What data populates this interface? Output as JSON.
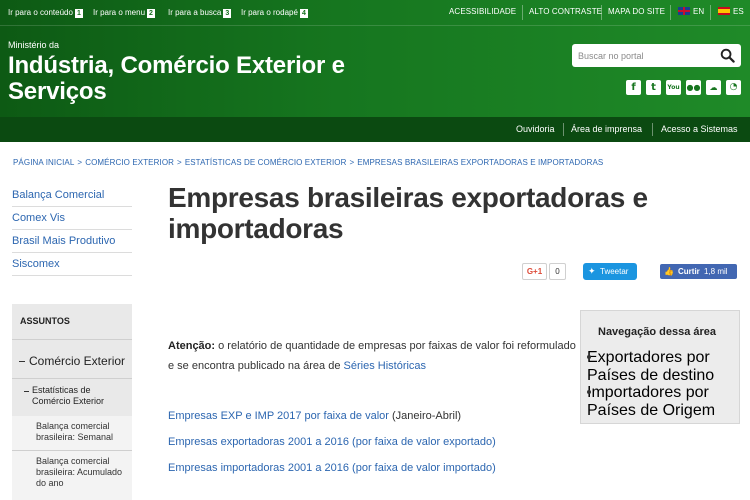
{
  "skip_links": [
    {
      "label": "Ir para o conteúdo",
      "key": "1"
    },
    {
      "label": "Ir para o menu",
      "key": "2"
    },
    {
      "label": "Ir para a busca",
      "key": "3"
    },
    {
      "label": "Ir para o rodapé",
      "key": "4"
    }
  ],
  "top_links": {
    "accessibility": "ACESSIBILIDADE",
    "contrast": "ALTO CONTRASTE",
    "sitemap": "MAPA DO SITE",
    "lang_en": "EN",
    "lang_es": "ES"
  },
  "site": {
    "kicker": "Ministério da",
    "title": "Indústria, Comércio Exterior e Serviços"
  },
  "search": {
    "placeholder": "Buscar no portal"
  },
  "social_icons": [
    "facebook-icon",
    "twitter-icon",
    "youtube-icon",
    "flickr-icon",
    "soundcloud-icon",
    "rss-icon"
  ],
  "subnav": {
    "ouvidoria": "Ouvidoria",
    "press": "Área de imprensa",
    "systems": "Acesso a Sistemas"
  },
  "breadcrumb": [
    "PÁGINA INICIAL",
    "COMÉRCIO EXTERIOR",
    "ESTATÍSTICAS DE COMÉRCIO EXTERIOR",
    "EMPRESAS BRASILEIRAS EXPORTADORAS E IMPORTADORAS"
  ],
  "sidebar": {
    "links": [
      "Balança Comercial",
      "Comex Vis",
      "Brasil Mais Produtivo",
      "Siscomex"
    ],
    "assuntos_title": "ASSUNTOS",
    "menu_level1": "Comércio Exterior",
    "menu_level2": "Estatísticas de Comércio Exterior",
    "menu_level3": [
      "Balança comercial brasileira: Semanal",
      "Balança comercial brasileira: Acumulado do ano"
    ]
  },
  "main": {
    "title": "Empresas brasileiras exportadoras e importadoras",
    "share": {
      "gplus_label": "G+1",
      "gplus_count": "0",
      "tweet_label": "Tweetar",
      "fb_label": "Curtir",
      "fb_count": "1,8 mil"
    },
    "attention_label": "Atenção:",
    "attention_text": " o relatório de quantidade de empresas por faixas de valor foi reformulado e se encontra publicado na área de ",
    "attention_link": "Séries Históricas",
    "lines": [
      {
        "link": "Empresas EXP e IMP 2017 por faixa de valor",
        "suffix": " (Janeiro-Abril)"
      },
      {
        "link": "Empresas exportadoras 2001 a 2016 (por faixa de valor exportado)",
        "suffix": ""
      },
      {
        "link": "Empresas importadoras 2001 a 2016 (por faixa de valor importado)",
        "suffix": ""
      }
    ]
  },
  "navbox": {
    "title": "Navegação dessa área",
    "items": [
      "Exportadores por Países de destino",
      "Importadores por Países de Origem"
    ]
  }
}
